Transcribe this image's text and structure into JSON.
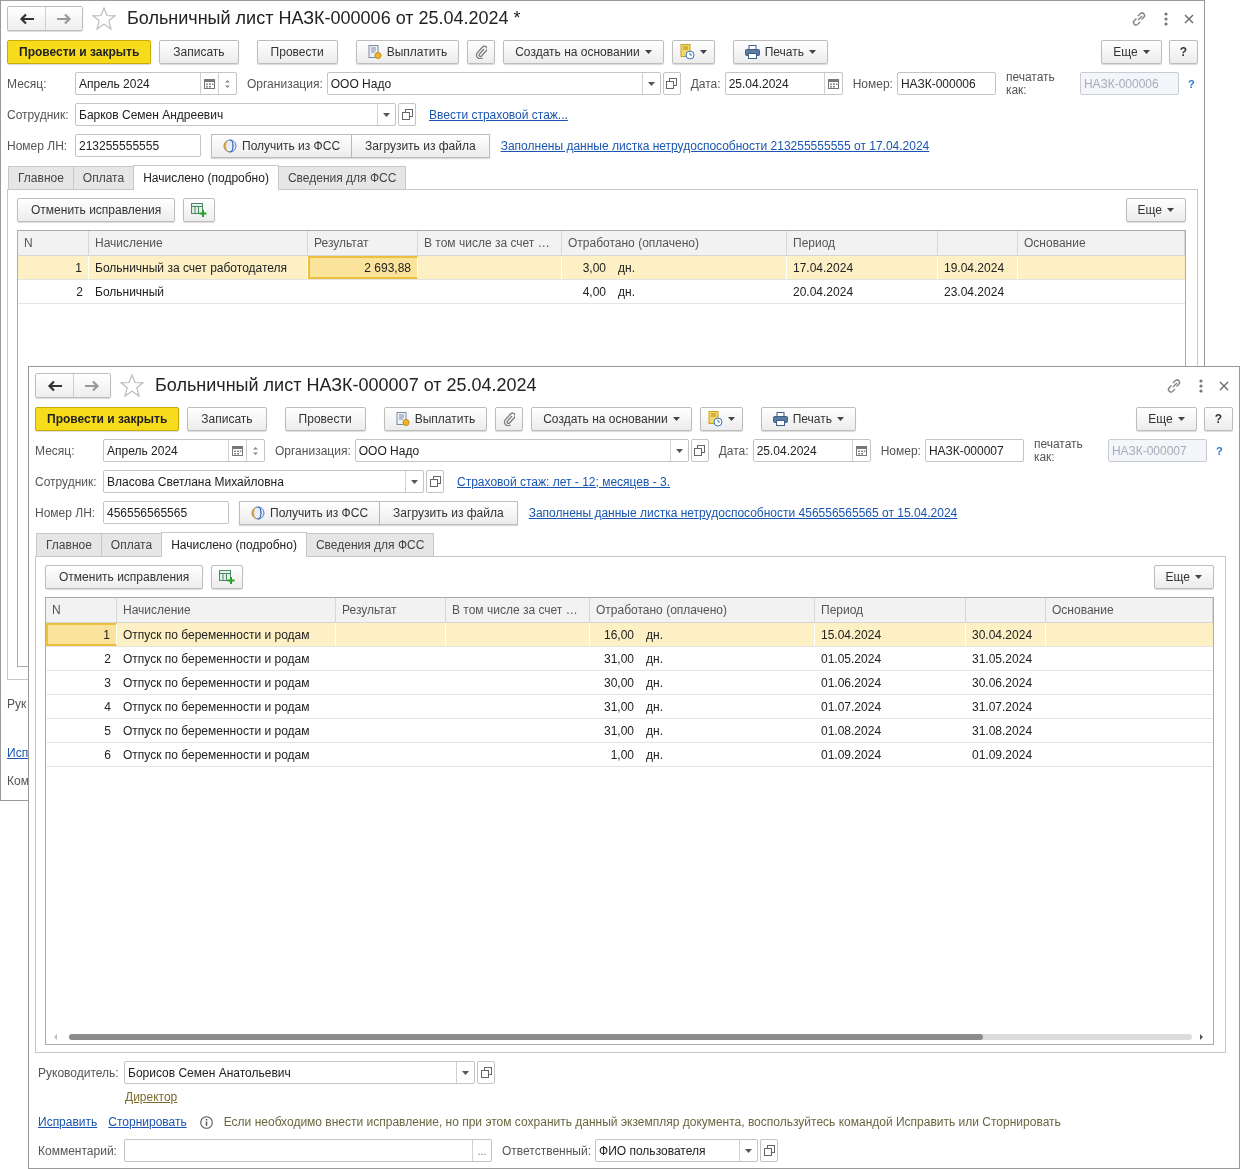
{
  "windows": [
    {
      "title": "Больничный лист НАЗК-000006 от 25.04.2024 *",
      "toolbar": [
        [
          {
            "kind": "primary",
            "label": "Провести и закрыть"
          },
          {
            "kind": "plain",
            "label": "Записать"
          }
        ],
        [
          {
            "kind": "plain",
            "label": "Провести"
          }
        ],
        [
          {
            "kind": "pay",
            "label": "Выплатить"
          },
          {
            "kind": "attach"
          },
          {
            "kind": "menu",
            "label": "Создать на основании"
          },
          {
            "kind": "docs"
          }
        ],
        [
          {
            "kind": "print",
            "label": "Печать"
          }
        ]
      ],
      "toolbar_right": [
        {
          "kind": "menu",
          "label": "Еще"
        },
        {
          "kind": "help",
          "label": "?"
        }
      ],
      "month": {
        "label": "Месяц:",
        "value": "Апрель 2024"
      },
      "organization": {
        "label": "Организация:",
        "value": "ООО Надо"
      },
      "date": {
        "label": "Дата:",
        "value": "25.04.2024"
      },
      "number": {
        "label": "Номер:",
        "value": "НАЗК-000006"
      },
      "print_as": {
        "label": "печатать как:",
        "value": "НАЗК-000006",
        "disabled": true
      },
      "hint_mark": "?",
      "employee": {
        "label": "Сотрудник:",
        "value": "Барков Семен Андреевич"
      },
      "employee_link": "Ввести страховой стаж...",
      "sick_note": {
        "label": "Номер ЛН:",
        "value": "213255555555"
      },
      "fss_buttons": [
        {
          "kind": "fss",
          "label": "Получить из ФСС"
        },
        {
          "kind": "plain",
          "label": "Загрузить из файла"
        }
      ],
      "sick_note_link": "Заполнены данные листка нетрудоспособности 213255555555 от 17.04.2024",
      "tabs": [
        {
          "label": "Главное",
          "selected": false
        },
        {
          "label": "Оплата",
          "selected": false
        },
        {
          "label": "Начислено (подробно)",
          "selected": true
        },
        {
          "label": "Сведения для ФСС",
          "selected": false
        }
      ],
      "table_toolbar": [
        {
          "kind": "plain",
          "label": "Отменить исправления"
        },
        {
          "kind": "add-column"
        }
      ],
      "table_more": {
        "kind": "menu",
        "label": "Еще"
      },
      "table": {
        "columns": [
          {
            "kind": "text",
            "label": "N"
          },
          {
            "kind": "text",
            "label": "Начисление"
          },
          {
            "kind": "text",
            "label": "Результат"
          },
          {
            "kind": "text",
            "label": "В том числе за счет …"
          },
          {
            "kind": "text",
            "label": "Отработано (оплачено)"
          },
          {
            "kind": "text",
            "label": "Период"
          },
          {
            "kind": "blank"
          },
          {
            "kind": "text",
            "label": "Основание"
          }
        ],
        "rows": [
          {
            "n": "1",
            "accrual": "Больничный за счет работодателя",
            "result": {
              "text": "2 693,88",
              "focused": true
            },
            "days": "3,00",
            "unit": "дн.",
            "start": "17.04.2024",
            "end": "19.04.2024",
            "selected": true
          },
          {
            "n": "2",
            "accrual": "Больничный",
            "days": "4,00",
            "unit": "дн.",
            "start": "20.04.2024",
            "end": "23.04.2024",
            "selected": false
          }
        ]
      },
      "footer_cut": [
        {
          "kind": "label",
          "text": "Рук"
        },
        {
          "kind": "link",
          "text": "Исп"
        },
        {
          "kind": "label",
          "text": "Ком"
        }
      ]
    },
    {
      "title": "Больничный лист НАЗК-000007 от 25.04.2024",
      "toolbar": [
        [
          {
            "kind": "primary",
            "label": "Провести и закрыть"
          },
          {
            "kind": "plain",
            "label": "Записать"
          }
        ],
        [
          {
            "kind": "plain",
            "label": "Провести"
          }
        ],
        [
          {
            "kind": "pay",
            "label": "Выплатить"
          },
          {
            "kind": "attach"
          },
          {
            "kind": "menu",
            "label": "Создать на основании"
          },
          {
            "kind": "docs"
          }
        ],
        [
          {
            "kind": "print",
            "label": "Печать"
          }
        ]
      ],
      "toolbar_right": [
        {
          "kind": "menu",
          "label": "Еще"
        },
        {
          "kind": "help",
          "label": "?"
        }
      ],
      "month": {
        "label": "Месяц:",
        "value": "Апрель 2024"
      },
      "organization": {
        "label": "Организация:",
        "value": "ООО Надо"
      },
      "date": {
        "label": "Дата:",
        "value": "25.04.2024"
      },
      "number": {
        "label": "Номер:",
        "value": "НАЗК-000007"
      },
      "print_as": {
        "label": "печатать как:",
        "value": "НАЗК-000007",
        "disabled": true
      },
      "hint_mark": "?",
      "employee": {
        "label": "Сотрудник:",
        "value": "Власова Светлана Михайловна"
      },
      "employee_link": "Страховой стаж: лет - 12; месяцев - 3.",
      "sick_note": {
        "label": "Номер ЛН:",
        "value": "456556565565"
      },
      "fss_buttons": [
        {
          "kind": "fss",
          "label": "Получить из ФСС"
        },
        {
          "kind": "plain",
          "label": "Загрузить из файла"
        }
      ],
      "sick_note_link": "Заполнены данные листка нетрудоспособности 456556565565 от 15.04.2024",
      "tabs": [
        {
          "label": "Главное",
          "selected": false
        },
        {
          "label": "Оплата",
          "selected": false
        },
        {
          "label": "Начислено (подробно)",
          "selected": true
        },
        {
          "label": "Сведения для ФСС",
          "selected": false
        }
      ],
      "table_toolbar": [
        {
          "kind": "plain",
          "label": "Отменить исправления"
        },
        {
          "kind": "add-column"
        }
      ],
      "table_more": {
        "kind": "menu",
        "label": "Еще"
      },
      "table": {
        "columns": [
          {
            "kind": "text",
            "label": "N"
          },
          {
            "kind": "text",
            "label": "Начисление"
          },
          {
            "kind": "text",
            "label": "Результат"
          },
          {
            "kind": "text",
            "label": "В том числе за счет …"
          },
          {
            "kind": "text",
            "label": "Отработано (оплачено)"
          },
          {
            "kind": "text",
            "label": "Период"
          },
          {
            "kind": "blank"
          },
          {
            "kind": "text",
            "label": "Основание"
          }
        ],
        "rows": [
          {
            "n": {
              "text": "1",
              "focused": true
            },
            "accrual": "Отпуск по беременности и родам",
            "days": "16,00",
            "unit": "дн.",
            "start": "15.04.2024",
            "end": "30.04.2024",
            "selected": true
          },
          {
            "n": "2",
            "accrual": "Отпуск по беременности и родам",
            "days": "31,00",
            "unit": "дн.",
            "start": "01.05.2024",
            "end": "31.05.2024",
            "selected": false
          },
          {
            "n": "3",
            "accrual": "Отпуск по беременности и родам",
            "days": "30,00",
            "unit": "дн.",
            "start": "01.06.2024",
            "end": "30.06.2024",
            "selected": false
          },
          {
            "n": "4",
            "accrual": "Отпуск по беременности и родам",
            "days": "31,00",
            "unit": "дн.",
            "start": "01.07.2024",
            "end": "31.07.2024",
            "selected": false
          },
          {
            "n": "5",
            "accrual": "Отпуск по беременности и родам",
            "days": "31,00",
            "unit": "дн.",
            "start": "01.08.2024",
            "end": "31.08.2024",
            "selected": false
          },
          {
            "n": "6",
            "accrual": "Отпуск по беременности и родам",
            "days": "1,00",
            "unit": "дн.",
            "start": "01.09.2024",
            "end": "01.09.2024",
            "selected": false
          }
        ]
      },
      "manager": {
        "label": "Руководитель:",
        "value": "Борисов Семен Анатольевич"
      },
      "position_link": "Директор",
      "actions": [
        "Исправить",
        "Сторнировать"
      ],
      "info": "Если необходимо внести исправление, но при этом сохранить данный экземпляр документа, воспользуйтесь командой Исправить или Сторнировать",
      "comment": {
        "label": "Комментарий:",
        "button_label": "..."
      },
      "responsible": {
        "label": "Ответственный:",
        "value": "ФИО пользователя"
      }
    }
  ]
}
